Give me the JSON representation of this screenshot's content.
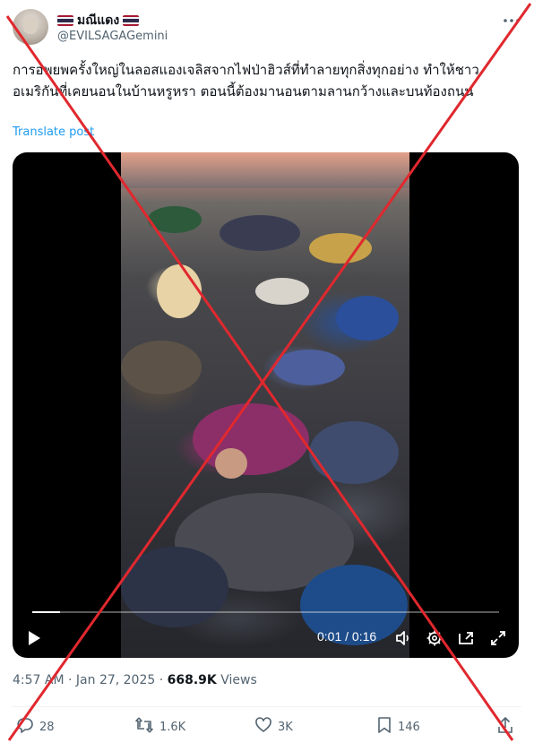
{
  "author": {
    "display_name": "มณีแดง",
    "handle": "@EVILSAGAGemini",
    "flag_icon": "thailand-flag-icon"
  },
  "tweet": {
    "text": "การอพยพครั้งใหญ่ในลอสแองเจลิสจากไฟป่าฮิวส์ที่ทำลายทุกสิ่งทุกอย่าง ทำให้ชาวอเมริกันที่เคยนอนในบ้านหรูหรา ตอนนี้ต้องมานอนตามลานกว้างและบนท้องถนน",
    "translate_label": "Translate post"
  },
  "video": {
    "current_time": "0:01",
    "separator": " / ",
    "duration": "0:16",
    "progress": 0.06,
    "controls": [
      "play-icon",
      "volume-icon",
      "settings-icon",
      "picture-in-picture-icon",
      "fullscreen-icon"
    ]
  },
  "meta": {
    "time": "4:57 AM",
    "dot1": " · ",
    "date": "Jan 27, 2025",
    "dot2": " · ",
    "views_count": "668.9K",
    "views_label": " Views"
  },
  "actions": {
    "replies": "28",
    "reposts": "1.6K",
    "likes": "3K",
    "bookmarks": "146"
  },
  "colors": {
    "accent": "#1d9bf0",
    "secondary_text": "#536471",
    "overlay_x": "#e0282e"
  }
}
